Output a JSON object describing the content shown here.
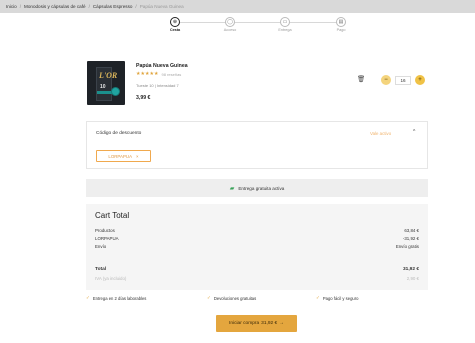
{
  "breadcrumb": {
    "items": [
      "Inicio",
      "Monodosis y cápsulas de café",
      "Cápsulas Espresso",
      "Papúa Nueva Guinea"
    ],
    "separator": "/"
  },
  "steps": [
    {
      "label": "Cesta",
      "icon": "basket-icon",
      "active": true
    },
    {
      "label": "Acceso",
      "icon": "user-icon",
      "active": false
    },
    {
      "label": "Entrega",
      "icon": "truck-icon",
      "active": false
    },
    {
      "label": "Pago",
      "icon": "card-icon",
      "active": false
    }
  ],
  "product": {
    "thumb_brand": "L'OR",
    "thumb_number": "10",
    "name": "Papúa Nueva Guinea",
    "stars": "★★★★★",
    "rating_count": "98 reseñas",
    "meta": "Tueste 10 | Intensidad 7",
    "price": "3,99 €",
    "quantity": "16",
    "minus": "−",
    "plus": "+",
    "trash_icon": "trash-icon"
  },
  "coupon": {
    "title": "Código de descuento",
    "status": "Vale activo",
    "caret": "^",
    "code": "LORPAPUA",
    "remove": "×"
  },
  "shipping_banner": {
    "icon": "truck-icon",
    "text": "Entrega gratuita activa"
  },
  "cart_total": {
    "title": "Cart Total",
    "rows": [
      {
        "label": "Productos",
        "value": "63,84 €"
      },
      {
        "label": "LORPAPUA",
        "value": "-31,92 €"
      },
      {
        "label": "Envío",
        "value": "Envío gratis"
      }
    ],
    "total": {
      "label": "Total",
      "value": "31,92 €"
    },
    "iva": {
      "label": "IVA (ya incluido)",
      "value": "2,90 €"
    }
  },
  "benefits": [
    {
      "check": "✓",
      "text": "Entrega en 2 días laborables"
    },
    {
      "check": "✓",
      "text": "Devoluciones gratuitas"
    },
    {
      "check": "✓",
      "text": "Pago fácil y seguro"
    }
  ],
  "checkout": {
    "label": "Iniciar compra",
    "amount": "31,92 €",
    "arrow": "→"
  },
  "colors": {
    "accent": "#e4a63e",
    "coupon": "#f0a94e",
    "banner_bg": "#eeeeee",
    "cart_bg": "#f5f5f5",
    "topbar": "#d9d9d9"
  }
}
